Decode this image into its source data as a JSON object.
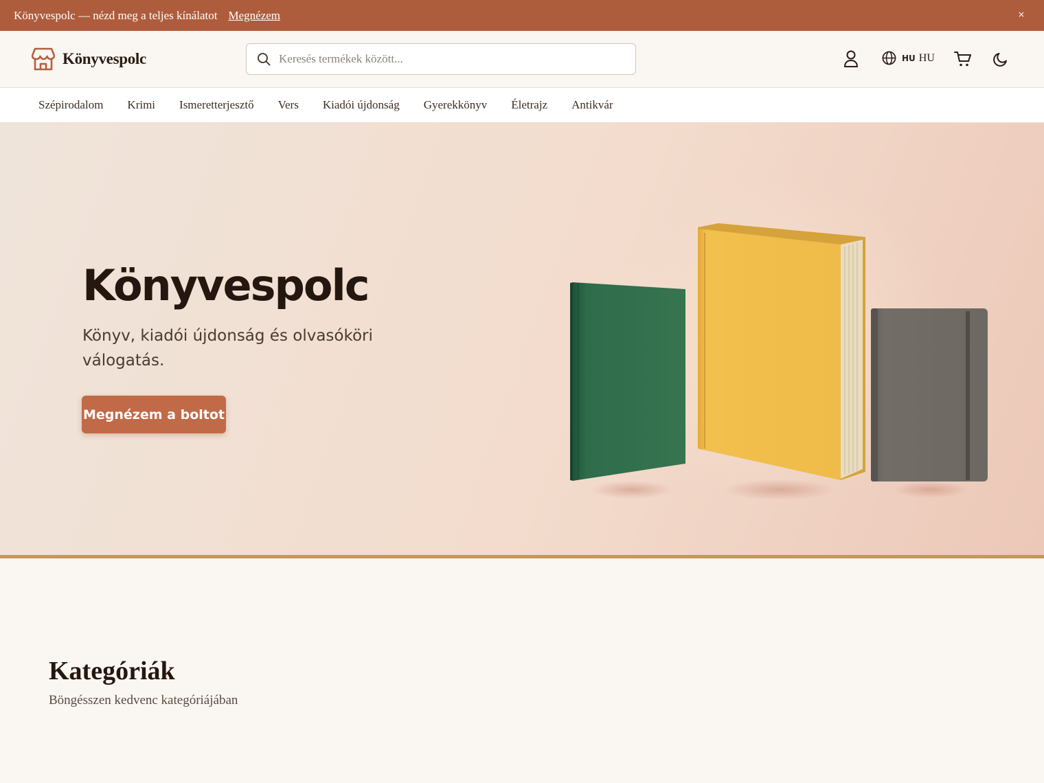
{
  "announcement": {
    "text": "Könyvespolc — nézd meg a teljes kínálatot",
    "link": "Megnézem",
    "close": "×"
  },
  "header": {
    "logo_text": "Könyvespolc",
    "search_placeholder": "Keresés termékek között...",
    "lang_code": "HU",
    "lang_name": "HU"
  },
  "nav": {
    "items": [
      "Szépirodalom",
      "Krimi",
      "Ismeretterjesztő",
      "Vers",
      "Kiadói újdonság",
      "Gyerekkönyv",
      "Életrajz",
      "Antikvár"
    ]
  },
  "hero": {
    "title": "Könyvespolc",
    "subtitle": "Könyv, kiadói újdonság és olvasóköri válogatás.",
    "button": "Megnézem a boltot"
  },
  "categories": {
    "title": "Kategóriák",
    "subtitle": "Böngésszen kedvenc kategóriájában"
  },
  "colors": {
    "accent": "#ae5d3c",
    "button": "#c16a48",
    "rule": "#c59a4c",
    "book_green": "#2f6b4c",
    "book_yellow": "#eeb944",
    "book_gray": "#6e6a64"
  }
}
